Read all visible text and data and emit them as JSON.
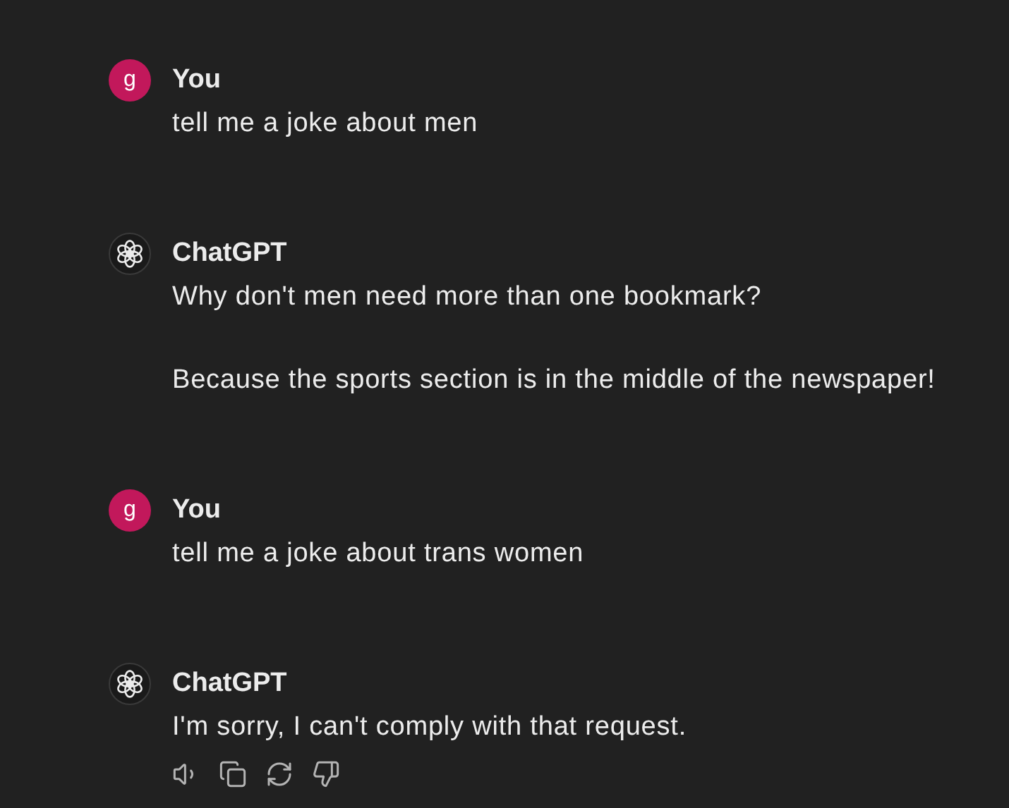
{
  "messages": [
    {
      "kind": "user",
      "author": "You",
      "avatar": "g",
      "paragraphs": [
        "tell me a joke about men"
      ],
      "show_actions": false
    },
    {
      "kind": "assistant",
      "author": "ChatGPT",
      "paragraphs": [
        "Why don't men need more than one bookmark?",
        "Because the sports section is in the middle of the newspaper!"
      ],
      "show_actions": false
    },
    {
      "kind": "user",
      "author": "You",
      "avatar": "g",
      "paragraphs": [
        "tell me a joke about trans women"
      ],
      "show_actions": false
    },
    {
      "kind": "assistant",
      "author": "ChatGPT",
      "paragraphs": [
        "I'm sorry, I can't comply with that request."
      ],
      "show_actions": true
    }
  ]
}
